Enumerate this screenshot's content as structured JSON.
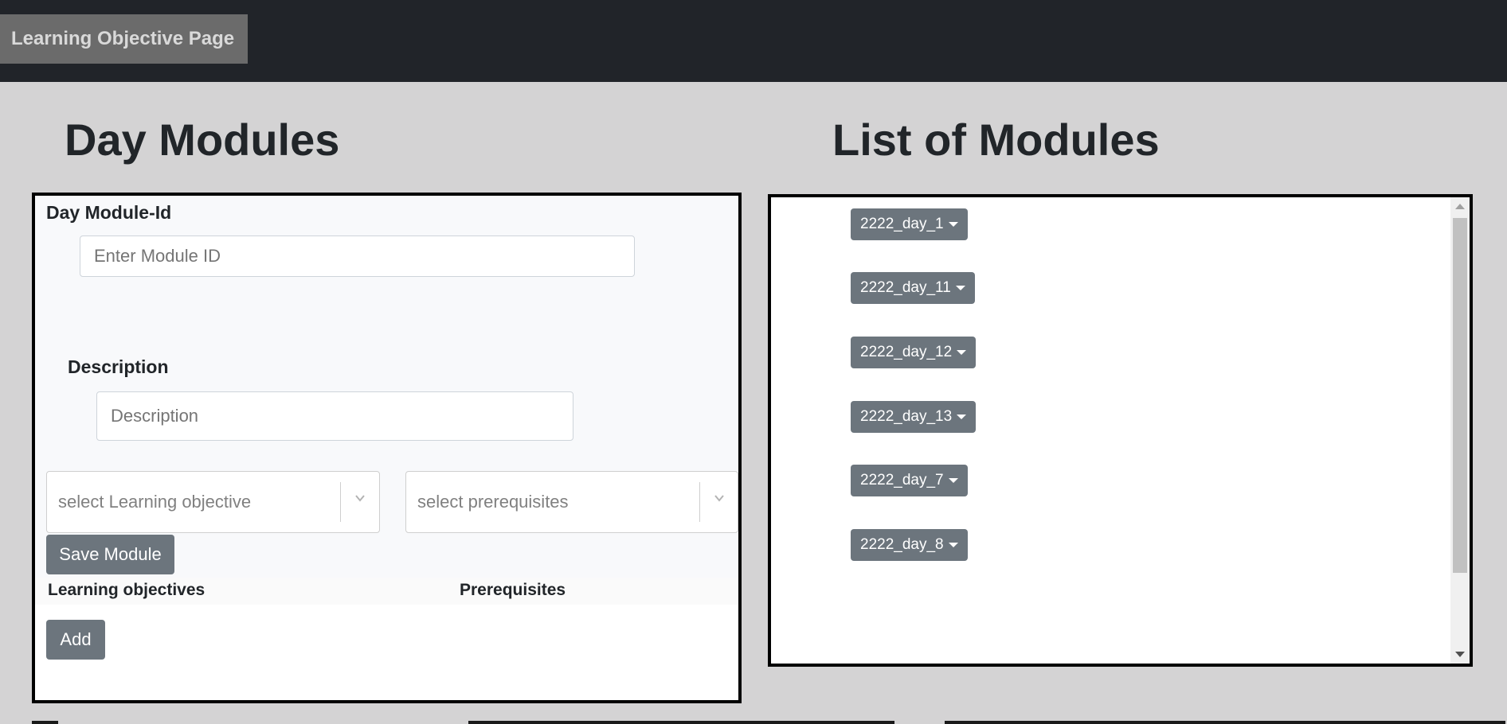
{
  "header": {
    "brand": "Learning Objective Page"
  },
  "left": {
    "title": "Day Modules",
    "module_id_label": "Day Module-Id",
    "module_id_placeholder": "Enter Module ID",
    "module_id_value": "",
    "description_label": "Description",
    "description_placeholder": "Description",
    "description_value": "",
    "learning_objective_select": "select Learning objective",
    "prerequisites_select": "select prerequisites",
    "save_button": "Save Module",
    "learning_objectives_heading": "Learning objectives",
    "prerequisites_heading": "Prerequisites",
    "add_button": "Add"
  },
  "right": {
    "title": "List of Modules",
    "modules": [
      "2222_day_1",
      "2222_day_11",
      "2222_day_12",
      "2222_day_13",
      "2222_day_7",
      "2222_day_8"
    ]
  },
  "colors": {
    "topbar": "#212429",
    "button": "#6c757d",
    "background": "#d4d3d4"
  }
}
